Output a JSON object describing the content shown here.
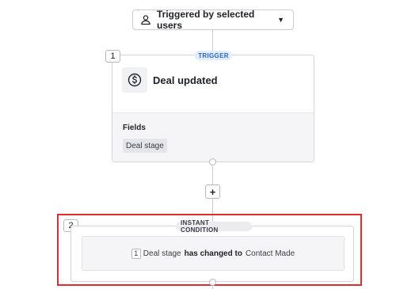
{
  "trigger_selector": {
    "label": "Triggered by selected users",
    "icon": "user-icon"
  },
  "step1": {
    "number": "1",
    "badge": "TRIGGER",
    "title": "Deal updated",
    "icon": "dollar-circle-icon",
    "fields_label": "Fields",
    "fields": [
      "Deal stage"
    ]
  },
  "add_step": {
    "label": "+"
  },
  "step2": {
    "number": "2",
    "badge": "INSTANT CONDITION",
    "condition": {
      "step_ref": "1",
      "field": "Deal stage",
      "operator": "has changed to",
      "value": "Contact Made"
    }
  },
  "colors": {
    "accent": "#2e62d9",
    "highlight": "#e22b2b"
  }
}
